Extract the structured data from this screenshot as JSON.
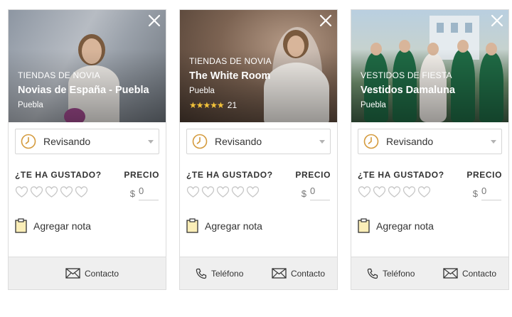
{
  "cards": [
    {
      "category": "TIENDAS DE NOVIA",
      "name": "Novias de España - Puebla",
      "city": "Puebla",
      "status": "Revisando",
      "liked_question": "¿TE HA GUSTADO?",
      "price_label": "PRECIO",
      "currency": "$",
      "price_value": "0",
      "note_label": "Agregar nota",
      "contact_label": "Contacto"
    },
    {
      "category": "TIENDAS DE NOVIA",
      "name": "The White Room",
      "city": "Puebla",
      "rating": 5,
      "review_count": "21",
      "status": "Revisando",
      "liked_question": "¿TE HA GUSTADO?",
      "price_label": "PRECIO",
      "currency": "$",
      "price_value": "0",
      "note_label": "Agregar nota",
      "phone_label": "Teléfono",
      "contact_label": "Contacto"
    },
    {
      "category": "VESTIDOS DE FIESTA",
      "name": "Vestidos Damaluna",
      "city": "Puebla",
      "status": "Revisando",
      "liked_question": "¿TE HA GUSTADO?",
      "price_label": "PRECIO",
      "currency": "$",
      "price_value": "0",
      "note_label": "Agregar nota",
      "phone_label": "Teléfono",
      "contact_label": "Contacto"
    }
  ],
  "colors": {
    "accent": "#d49a3c",
    "star": "#f2c23a",
    "footer_bg": "#efefef",
    "border": "#dcdcdc"
  },
  "icons": {
    "close": "close-icon",
    "status": "clock-icon",
    "dropdown": "caret-down-icon",
    "heart": "heart-outline-icon",
    "note": "sticky-note-icon",
    "phone": "phone-icon",
    "mail": "envelope-icon"
  }
}
